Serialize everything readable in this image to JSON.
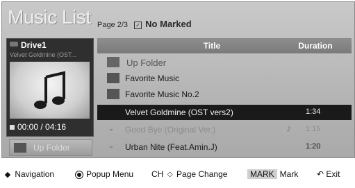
{
  "header": {
    "title": "Music List",
    "page": "Page 2/3",
    "mark_status": "No Marked"
  },
  "drive": {
    "name": "Drive1",
    "current_song": "Velvet Goldmine (OST...",
    "time": "00:00 / 04:16"
  },
  "up_folder_button": "Up Folder",
  "list": {
    "columns": {
      "title": "Title",
      "duration": "Duration"
    },
    "rows": [
      {
        "type": "up-folder",
        "title": "Up Folder",
        "duration": ""
      },
      {
        "type": "folder",
        "title": "Favorite Music",
        "duration": ""
      },
      {
        "type": "folder",
        "title": "Favorite Music No.2",
        "duration": ""
      },
      {
        "type": "song",
        "title": "Velvet Goldmine (OST vers2)",
        "duration": "1:34",
        "selected": true
      },
      {
        "type": "song",
        "title": "Good Bye (Original Ver.)",
        "duration": "1:15",
        "dim": true,
        "playing": true
      },
      {
        "type": "song",
        "title": "Urban Nite (Feat.Amin.J)",
        "duration": "1:20"
      }
    ]
  },
  "help": {
    "navigation": "Navigation",
    "popup_menu": "Popup Menu",
    "ch": "CH",
    "page_change": "Page Change",
    "mark_badge": "MARK",
    "mark": "Mark",
    "exit": "Exit"
  }
}
